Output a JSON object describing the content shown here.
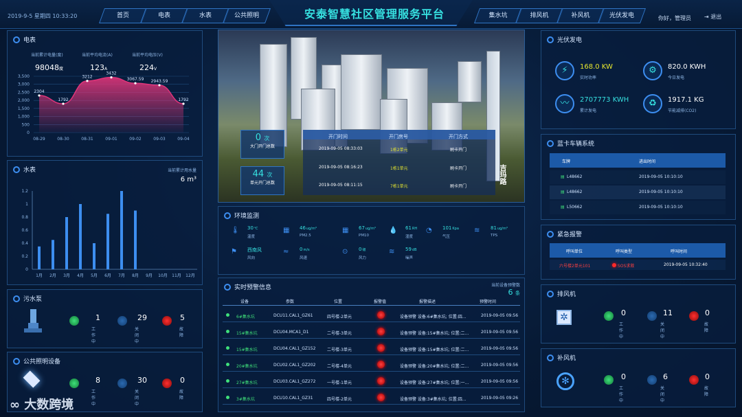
{
  "header": {
    "datetime": "2019-9-5 星期四 10:33:20",
    "title": "安泰智慧社区管理服务平台",
    "tabs_left": [
      "首页",
      "电表",
      "水表",
      "公共照明"
    ],
    "tabs_right": [
      "集水坑",
      "排风机",
      "补风机",
      "光伏发电"
    ],
    "greeting": "你好，管理员",
    "logout": "退出"
  },
  "electric": {
    "title": "电表",
    "stats": [
      {
        "label": "当前累计电量(度)",
        "value": "98048",
        "unit": "度"
      },
      {
        "label": "当前平均电流(A)",
        "value": "123",
        "unit": "A"
      },
      {
        "label": "当前平均电压(V)",
        "value": "224",
        "unit": "V"
      }
    ],
    "chart_data": {
      "type": "area",
      "categories": [
        "08-29",
        "08-30",
        "08-31",
        "09-01",
        "09-02",
        "09-03",
        "09-04"
      ],
      "values": [
        2304,
        1792,
        3212,
        3432,
        3067.59,
        2943.59,
        1792
      ],
      "ylim": [
        0,
        3500
      ],
      "yticks": [
        "0",
        "500",
        "1,000",
        "1,500",
        "2,000",
        "2,500",
        "3,000",
        "3,500"
      ],
      "value_labels": [
        "2304",
        "1792",
        "3212",
        "3432",
        "3067.59",
        "2943.59",
        "1792"
      ],
      "color": "#e0357a"
    }
  },
  "water": {
    "title": "水表",
    "total_label": "当前累计用水量",
    "total": "6",
    "unit": "m³",
    "chart_data": {
      "type": "bar",
      "categories": [
        "1月",
        "2月",
        "3月",
        "4月",
        "5月",
        "6月",
        "7月",
        "8月",
        "9月",
        "10月",
        "11月",
        "12月"
      ],
      "values": [
        0.35,
        0.45,
        0.8,
        1.0,
        0.4,
        0.85,
        1.2,
        0.9,
        0,
        0,
        0,
        0
      ],
      "ylim": [
        0,
        1.2
      ],
      "yticks": [
        "0",
        "0.2",
        "0.4",
        "0.6",
        "0.8",
        "1",
        "1.2"
      ],
      "color": "#3d8ef0"
    }
  },
  "sewage": {
    "title": "污水泵",
    "working": "1",
    "closed": "29",
    "fault": "5",
    "working_label": "工作中",
    "closed_label": "关闭中",
    "fault_label": "故障"
  },
  "lighting": {
    "title": "公共照明设备",
    "working": "8",
    "closed": "30",
    "fault": "0",
    "working_label": "工作中",
    "closed_label": "关闭中",
    "fault_label": "故障"
  },
  "door": {
    "gate_count": "0",
    "gate_unit": "次",
    "gate_label": "大门开门总数",
    "unit_count": "44",
    "unit_unit": "次",
    "unit_label": "单元开门总数",
    "headers": [
      "开门时间",
      "开门房号",
      "开门方式"
    ],
    "rows": [
      [
        "2019-09-05 08:33:03",
        "1栋2单元",
        "刷卡开门"
      ],
      [
        "2019-09-05 08:16:23",
        "1栋1单元",
        "刷卡开门"
      ],
      [
        "2019-09-05 08:11:15",
        "7栋1单元",
        "刷卡开门"
      ]
    ],
    "road": "吉玛路"
  },
  "env": {
    "title": "环境监测",
    "items": [
      {
        "v": "30",
        "u": "℃",
        "l": "温度"
      },
      {
        "v": "46",
        "u": "ug/m³",
        "l": "PM2.5"
      },
      {
        "v": "67",
        "u": "ug/m³",
        "l": "PM10"
      },
      {
        "v": "61",
        "u": "RH",
        "l": "湿度"
      },
      {
        "v": "101",
        "u": "Kpa",
        "l": "气压"
      },
      {
        "v": "81",
        "u": "ug/m³",
        "l": "TPS"
      },
      {
        "v": "西南风",
        "u": "",
        "l": "风向"
      },
      {
        "v": "0",
        "u": "m/s",
        "l": "风速"
      },
      {
        "v": "0",
        "u": "级",
        "l": "风力"
      },
      {
        "v": "59",
        "u": "dB",
        "l": "噪声"
      }
    ]
  },
  "alarm": {
    "title": "实时预警信息",
    "count_label": "当前设备预警数",
    "count": "6",
    "count_unit": "条",
    "headers": [
      "设备",
      "参数",
      "位置",
      "报警值",
      "报警描述",
      "预警时间"
    ],
    "rows": [
      [
        "6#集水坑",
        "DCU11.CAL1_GZ61",
        "四号楼-2单元",
        "设备预警 设备:6#集水坑; 位置:四...",
        "2019-09-05 09:56"
      ],
      [
        "15#集水坑",
        "DCU04.MCA1_D1",
        "二号楼-3单元",
        "设备预警 设备:15#集水坑; 位置:二...",
        "2019-09-05 09:56"
      ],
      [
        "15#集水坑",
        "DCU04.CAL1_GZ152",
        "二号楼-3单元",
        "设备预警 设备:15#集水坑; 位置:二...",
        "2019-09-05 09:56"
      ],
      [
        "20#集水坑",
        "DCU02.CAL1_GZ202",
        "二号楼-4单元",
        "设备预警 设备:20#集水坑; 位置:二...",
        "2019-09-05 09:56"
      ],
      [
        "27#集水坑",
        "DCU03.CAL1_GZ272",
        "一号楼-1单元",
        "设备预警 设备:27#集水坑; 位置:一...",
        "2019-09-05 09:56"
      ],
      [
        "3#集水坑",
        "DCU10.CAL1_GZ31",
        "四号楼-2单元",
        "设备预警 设备:3#集水坑; 位置:四...",
        "2019-09-05 09:26"
      ]
    ]
  },
  "solar": {
    "title": "光伏发电",
    "items": [
      {
        "v": "168.0 KW",
        "l": "实时功率",
        "color": "#e6e62e"
      },
      {
        "v": "820.0 KWH",
        "l": "今日发电",
        "color": "#ffffff"
      },
      {
        "v": "2707773 KWH",
        "l": "累计发电",
        "color": "#36e0e0"
      },
      {
        "v": "1917.1 KG",
        "l": "节能减排(CO2)",
        "color": "#ffffff"
      }
    ]
  },
  "cars": {
    "title": "蓝卡车辆系统",
    "headers": [
      "车牌",
      "进出时间"
    ],
    "rows": [
      [
        "L48662",
        "2019-09-05 10:10:10"
      ],
      [
        "L48662",
        "2019-09-05 10:10:10"
      ],
      [
        "L50662",
        "2019-09-05 10:10:10"
      ]
    ]
  },
  "emergency": {
    "title": "紧急报警",
    "headers": [
      "呼叫单位",
      "呼叫类型",
      "呼叫时间"
    ],
    "rows": [
      [
        "六号楼2单元101",
        "SOS求救",
        "2019-09-05 10:32:40"
      ]
    ]
  },
  "exhaust": {
    "title": "排风机",
    "working": "0",
    "closed": "11",
    "fault": "0",
    "working_label": "工作中",
    "closed_label": "关闭中",
    "fault_label": "故障"
  },
  "supply": {
    "title": "补风机",
    "working": "0",
    "closed": "6",
    "fault": "0",
    "working_label": "工作中",
    "closed_label": "关闭中",
    "fault_label": "故障"
  },
  "watermark": "大数跨境"
}
